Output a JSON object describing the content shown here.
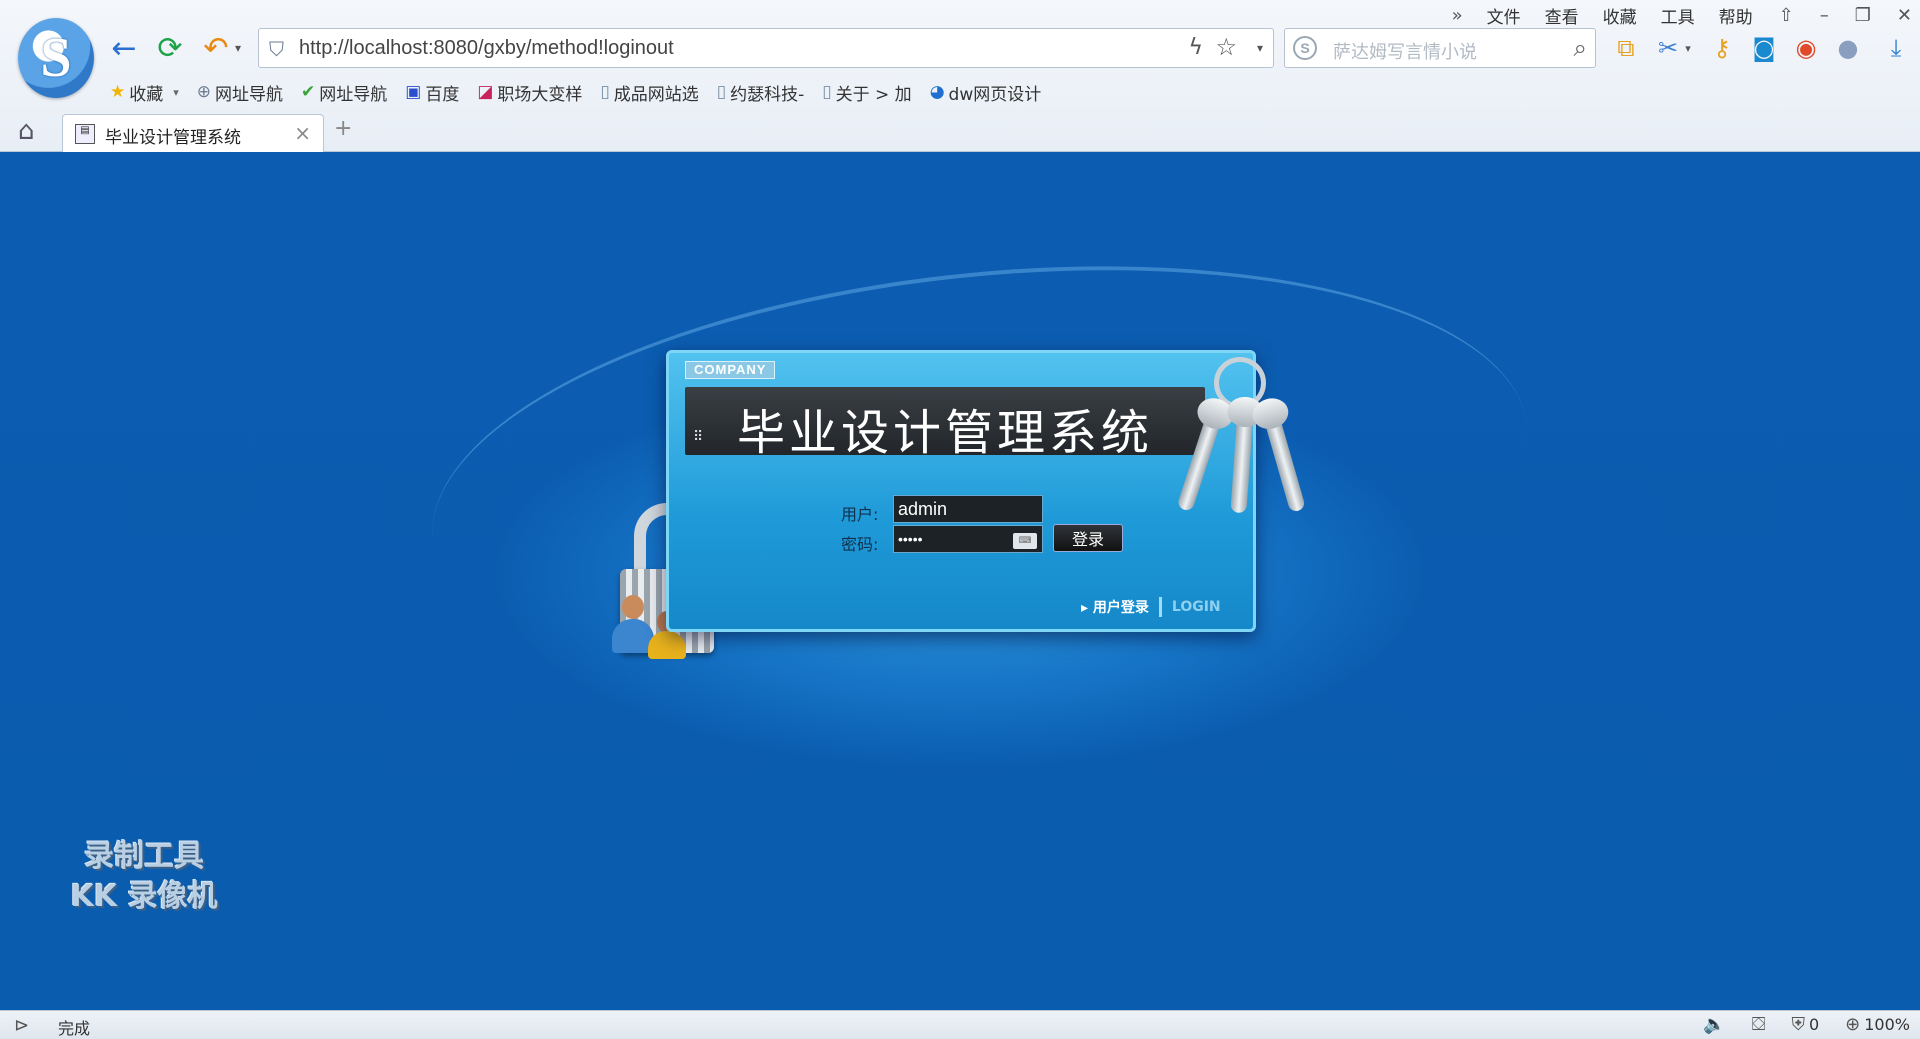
{
  "browser": {
    "logo_letter": "S",
    "url": "http://localhost:8080/gxby/method!loginout",
    "search_placeholder": "萨达姆写言情小说",
    "menu": [
      "文件",
      "查看",
      "收藏",
      "工具",
      "帮助"
    ],
    "bookmarks": [
      {
        "label": "收藏",
        "icon": "star-icon"
      },
      {
        "label": "网址导航",
        "icon": "globe-icon"
      },
      {
        "label": "网址导航",
        "icon": "hao-icon"
      },
      {
        "label": "百度",
        "icon": "baidu-paw-icon"
      },
      {
        "label": "职场大变样",
        "icon": "site-icon"
      },
      {
        "label": "成品网站选",
        "icon": "page-icon"
      },
      {
        "label": "约瑟科技-",
        "icon": "page-icon"
      },
      {
        "label": "关于 > 加",
        "icon": "page-icon"
      },
      {
        "label": "dw网页设计",
        "icon": "eye-icon"
      }
    ],
    "tab": {
      "label": "毕业设计管理系统"
    },
    "status": {
      "text": "完成",
      "security_count": "0",
      "zoom": "100%"
    }
  },
  "login": {
    "company_badge": "COMPANY",
    "title": "毕业设计管理系统",
    "user_label": "用户:",
    "user_value": "admin",
    "password_label": "密码:",
    "password_value": "•••••",
    "login_button": "登录",
    "link_user_login": "▸ 用户登录",
    "link_login": "LOGIN"
  },
  "watermark": {
    "line1": "录制工具",
    "line2": "KK 录像机"
  },
  "colors": {
    "page_bg": "#0a5eb0",
    "panel": "#1f9ad8",
    "title_bar": "#22262a"
  }
}
